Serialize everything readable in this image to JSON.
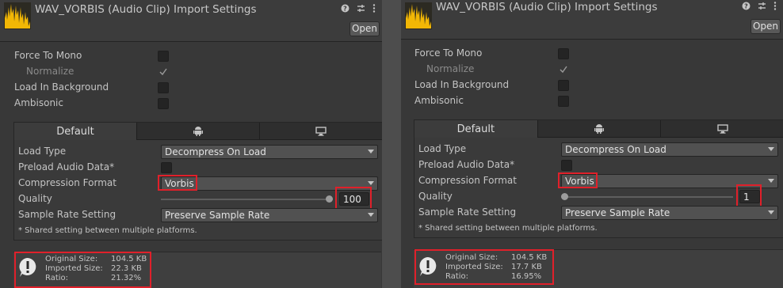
{
  "panels": [
    {
      "title": "WAV_VORBIS (Audio Clip) Import Settings",
      "open_label": "Open",
      "properties": [
        {
          "label": "Force To Mono",
          "checked": false
        },
        {
          "label": "Normalize",
          "checked": true
        },
        {
          "label": "Load In Background",
          "checked": false
        },
        {
          "label": "Ambisonic",
          "checked": false
        }
      ],
      "tabs": {
        "default_label": "Default",
        "android_icon": "android-icon",
        "desktop_icon": "monitor-icon"
      },
      "load_type_label": "Load Type",
      "load_type_value": "Decompress On Load",
      "preload_label": "Preload Audio Data*",
      "preload_checked": false,
      "compression_label": "Compression Format",
      "compression_value": "Vorbis",
      "quality_label": "Quality",
      "quality_value": "100",
      "quality_fraction": 1.0,
      "sample_rate_label": "Sample Rate Setting",
      "sample_rate_value": "Preserve Sample Rate",
      "shared_note": "* Shared setting between multiple platforms.",
      "info": {
        "original_label": "Original Size:",
        "original_value": "104.5 KB",
        "imported_label": "Imported Size:",
        "imported_value": "22.3 KB",
        "ratio_label": "Ratio:",
        "ratio_value": "21.32%"
      }
    },
    {
      "title": "WAV_VORBIS (Audio Clip) Import Settings",
      "open_label": "Open",
      "properties": [
        {
          "label": "Force To Mono",
          "checked": false
        },
        {
          "label": "Normalize",
          "checked": true
        },
        {
          "label": "Load In Background",
          "checked": false
        },
        {
          "label": "Ambisonic",
          "checked": false
        }
      ],
      "tabs": {
        "default_label": "Default",
        "android_icon": "android-icon",
        "desktop_icon": "monitor-icon"
      },
      "load_type_label": "Load Type",
      "load_type_value": "Decompress On Load",
      "preload_label": "Preload Audio Data*",
      "preload_checked": false,
      "compression_label": "Compression Format",
      "compression_value": "Vorbis",
      "quality_label": "Quality",
      "quality_value": "1",
      "quality_fraction": 0.0,
      "sample_rate_label": "Sample Rate Setting",
      "sample_rate_value": "Preserve Sample Rate",
      "shared_note": "* Shared setting between multiple platforms.",
      "info": {
        "original_label": "Original Size:",
        "original_value": "104.5 KB",
        "imported_label": "Imported Size:",
        "imported_value": "17.7 KB",
        "ratio_label": "Ratio:",
        "ratio_value": "16.95%"
      }
    }
  ],
  "colors": {
    "highlight": "#e0202a",
    "clip_icon": "#f2b705",
    "background": "#383838"
  },
  "icons": [
    "audio-clip-icon",
    "help-icon",
    "settings-icon",
    "menu-icon",
    "android-icon",
    "monitor-icon",
    "warning-icon",
    "chevron-down-icon",
    "checkmark-icon"
  ]
}
